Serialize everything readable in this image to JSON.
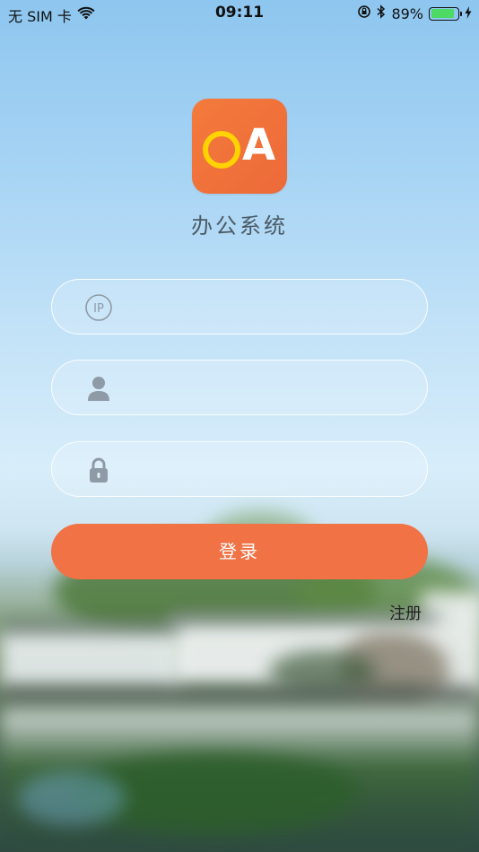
{
  "status_bar": {
    "carrier": "无 SIM 卡",
    "time": "09:11",
    "battery_percent": "89%",
    "battery_level": 0.89,
    "icons": [
      "wifi-icon",
      "rotation-lock-icon",
      "bluetooth-icon",
      "battery-icon",
      "charging-icon"
    ]
  },
  "app": {
    "logo_text": "A",
    "logo_icon": "oa-logo-icon",
    "title": "办公系统",
    "colors": {
      "accent": "#f07245",
      "logo_o": "#ffd200",
      "icon_gray": "#8e9aa6"
    }
  },
  "form": {
    "ip": {
      "icon": "ip-icon",
      "value": "",
      "placeholder": ""
    },
    "username": {
      "icon": "user-icon",
      "value": "",
      "placeholder": ""
    },
    "password": {
      "icon": "lock-icon",
      "value": "",
      "placeholder": ""
    },
    "login_label": "登录",
    "register_label": "注册"
  }
}
